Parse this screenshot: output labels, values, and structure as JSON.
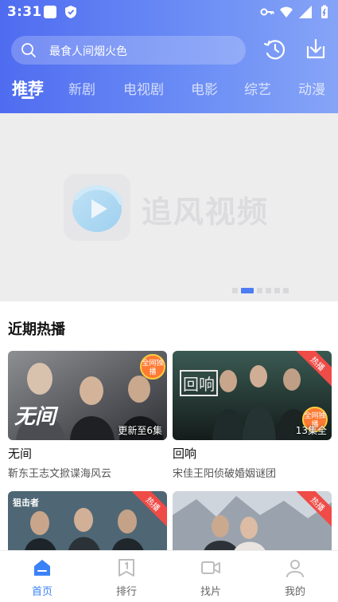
{
  "status_bar": {
    "time": "3:31"
  },
  "search": {
    "placeholder": "最食人间烟火色"
  },
  "tabs": [
    {
      "label": "推荐",
      "active": true
    },
    {
      "label": "新剧"
    },
    {
      "label": "电视剧"
    },
    {
      "label": "电影"
    },
    {
      "label": "综艺"
    },
    {
      "label": "动漫"
    }
  ],
  "banner": {
    "logo_text": "追风视频",
    "page_count": 6,
    "active_page": 2
  },
  "section": {
    "title": "近期热播",
    "items": [
      {
        "title": "无间",
        "desc": "靳东王志文掀谍海风云",
        "episode": "更新至6集",
        "badge": "全网独播",
        "poster_text": "无间"
      },
      {
        "title": "回响",
        "desc": "宋佳王阳侦破婚姻谜团",
        "episode": "13集全",
        "badge": "热播",
        "round_badge": "全网独播",
        "poster_text": "回响"
      },
      {
        "title": "",
        "desc": "",
        "badge": "热播",
        "poster_text": "狙击者"
      },
      {
        "title": "",
        "desc": "",
        "badge": "热播"
      }
    ]
  },
  "bottom_nav": [
    {
      "label": "首页",
      "icon": "home-icon",
      "active": true
    },
    {
      "label": "排行",
      "icon": "ranking-icon"
    },
    {
      "label": "找片",
      "icon": "video-camera-icon"
    },
    {
      "label": "我的",
      "icon": "profile-icon"
    }
  ],
  "colors": {
    "header_gradient_start": "#4f6cf0",
    "header_gradient_end": "#86a4f7",
    "accent": "#4d7cf3",
    "badge_red": "#ef4b47"
  }
}
